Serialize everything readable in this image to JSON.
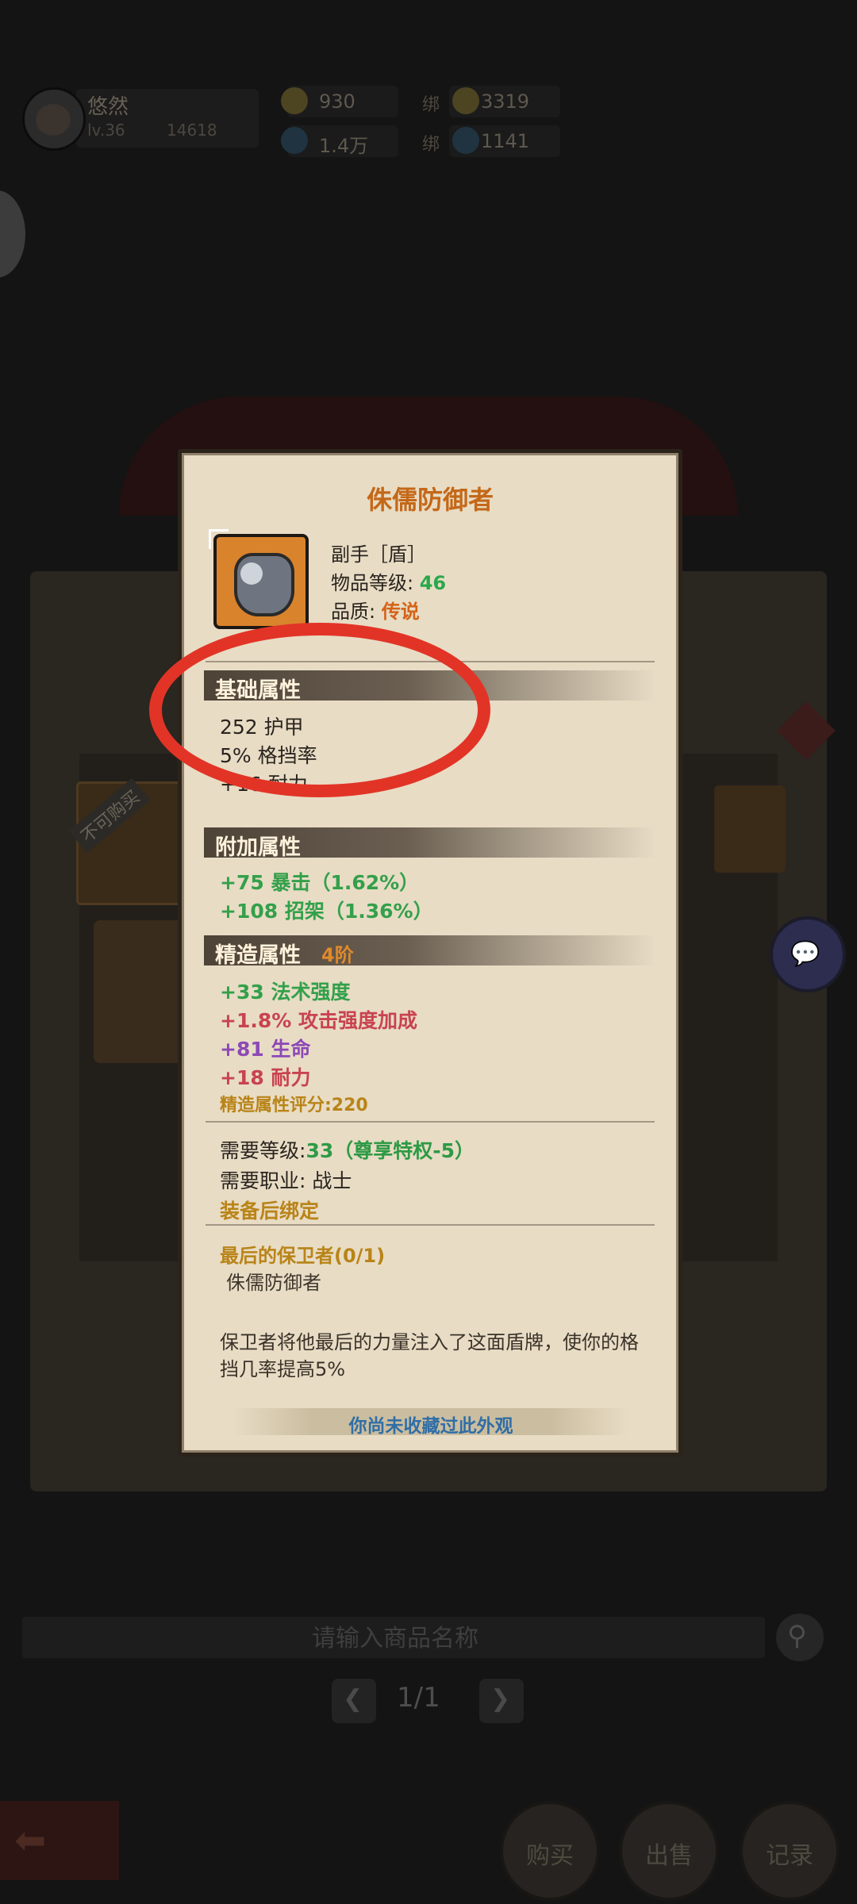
{
  "topbar": {
    "username": "悠然",
    "level": "lv.36",
    "power": "14618",
    "gold": "930",
    "bound_gold": "3319",
    "diamond": "1.4万",
    "bound_diamond": "1141",
    "bound_label": "绑"
  },
  "shop": {
    "not_buyable": "不可购买",
    "search_placeholder": "请输入商品名称",
    "page": "1/1",
    "buy_label": "购买",
    "sell_label": "出售",
    "record_label": "记录"
  },
  "item": {
    "name": "侏儒防御者",
    "slot": "副手［盾］",
    "item_level_label": "物品等级:",
    "item_level": "46",
    "quality_label": "品质:",
    "quality": "传说",
    "sections": {
      "base": "基础属性",
      "extra": "附加属性",
      "refine": "精造属性",
      "refine_tier": "4阶"
    },
    "base_stats": [
      "252 护甲",
      "5% 格挡率",
      "+16 耐力"
    ],
    "extra_stats": [
      "+75 暴击（1.62%）",
      "+108 招架（1.36%）"
    ],
    "refine_stats": [
      {
        "text": "+33 法术强度",
        "color": "#33a04a"
      },
      {
        "text": "+1.8% 攻击强度加成",
        "color": "#c84350"
      },
      {
        "text": "+81 生命",
        "color": "#8c49b6"
      },
      {
        "text": "+18 耐力",
        "color": "#c84350"
      }
    ],
    "refine_score": "精造属性评分:220",
    "required_level_label": "需要等级:",
    "required_level": "33（尊享特权-5）",
    "required_class": "需要职业: 战士",
    "bind_note": "装备后绑定",
    "set_name": "最后的保卫者(0/1)",
    "set_item": "侏儒防御者",
    "description": "保卫者将他最后的力量注入了这面盾牌，使你的格挡几率提高5%",
    "footer": "你尚未收藏过此外观"
  },
  "colors": {
    "annotation_ring": "#e23426",
    "title_orange": "#c46818",
    "card_bg": "#e8dcc5"
  }
}
